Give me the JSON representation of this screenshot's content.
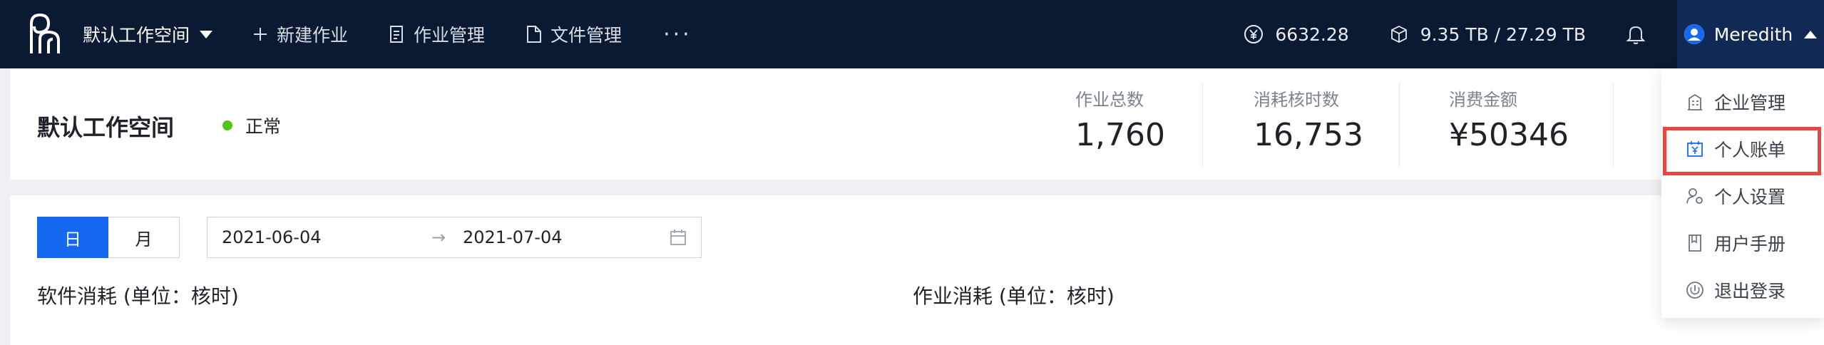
{
  "nav": {
    "workspace_name": "默认工作空间",
    "items": [
      {
        "label": "新建作业",
        "icon": "plus-icon"
      },
      {
        "label": "作业管理",
        "icon": "job-list-icon"
      },
      {
        "label": "文件管理",
        "icon": "file-icon"
      }
    ],
    "more": "···",
    "balance": "6632.28",
    "storage": "9.35 TB / 27.29 TB",
    "user": "Meredith"
  },
  "summary": {
    "title": "默认工作空间",
    "status": "正常",
    "status_color": "#52c41a",
    "metrics": [
      {
        "label": "作业总数",
        "value": "1,760"
      },
      {
        "label": "消耗核时数",
        "value": "16,753"
      },
      {
        "label": "消费金额",
        "value": "¥50346"
      }
    ]
  },
  "filters": {
    "day_label": "日",
    "month_label": "月",
    "start_date": "2021-06-04",
    "end_date": "2021-07-04",
    "arrow": "→"
  },
  "sections": {
    "software": "软件消耗 (单位：核时)",
    "jobs": "作业消耗 (单位：核时)"
  },
  "user_menu": [
    {
      "label": "企业管理",
      "icon": "enterprise-icon"
    },
    {
      "label": "个人账单",
      "icon": "bill-icon",
      "highlighted": true
    },
    {
      "label": "个人设置",
      "icon": "user-settings-icon"
    },
    {
      "label": "用户手册",
      "icon": "manual-icon"
    },
    {
      "label": "退出登录",
      "icon": "logout-icon"
    }
  ],
  "colors": {
    "topbar": "#0b1a33",
    "accent": "#1469f0",
    "highlight": "#e8463f"
  }
}
